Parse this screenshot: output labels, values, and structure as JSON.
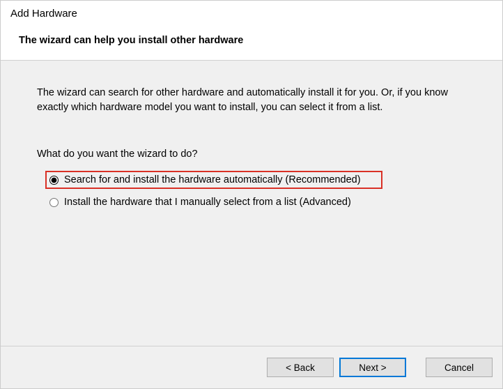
{
  "window": {
    "title": "Add Hardware",
    "subtitle": "The wizard can help you install other hardware"
  },
  "content": {
    "description": "The wizard can search for other hardware and automatically install it for you. Or, if you know exactly which hardware model you want to install, you can select it from a list.",
    "question": "What do you want the wizard to do?",
    "options": [
      {
        "label": "Search for and install the hardware automatically (Recommended)",
        "selected": true,
        "highlighted": true
      },
      {
        "label": "Install the hardware that I manually select from a list (Advanced)",
        "selected": false,
        "highlighted": false
      }
    ]
  },
  "footer": {
    "back": "< Back",
    "next": "Next >",
    "cancel": "Cancel"
  }
}
